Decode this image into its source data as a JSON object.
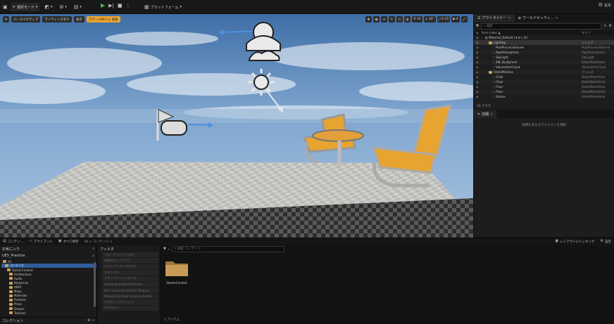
{
  "toolbar": {
    "mode": "選択モード",
    "platforms": "プラットフォーム"
  },
  "viewport": {
    "left_chips": [
      "パースペクティブ",
      "ライティングあり",
      "表示",
      "ステージIRシュ 再生"
    ],
    "numbers": [
      "10",
      "10°",
      "0.25",
      "4"
    ]
  },
  "outliner": {
    "tabs": [
      "アウトライナー",
      "ワールドセッティ..."
    ],
    "search_placeholder": "検索",
    "col_label": "Item Label ▲",
    "col_type": "タイプ",
    "rows": [
      {
        "label": "Material_Default (エディタ)",
        "type": "",
        "indent": 1,
        "kind": "world"
      },
      {
        "label": "Lighting",
        "type": "フォルダ",
        "indent": 2,
        "kind": "folder"
      },
      {
        "label": "PostProcessVolume",
        "type": "PostProcessVolume",
        "indent": 3,
        "kind": "actor"
      },
      {
        "label": "SkyAtmosphere",
        "type": "SkyAtmosphere",
        "indent": 3,
        "kind": "actor"
      },
      {
        "label": "SkyLight",
        "type": "SkyLight",
        "indent": 3,
        "kind": "actor"
      },
      {
        "label": "SM_SkySphere",
        "type": "StaticMeshActor",
        "indent": 3,
        "kind": "actor"
      },
      {
        "label": "VolumetricCloud",
        "type": "VolumetricCloud",
        "indent": 3,
        "kind": "actor"
      },
      {
        "label": "StaticMeshes",
        "type": "フォルダ",
        "indent": 2,
        "kind": "folder"
      },
      {
        "label": "Chair",
        "type": "StaticMeshActor",
        "indent": 3,
        "kind": "actor"
      },
      {
        "label": "Chair",
        "type": "StaticMeshActor",
        "indent": 3,
        "kind": "actor"
      },
      {
        "label": "Floor",
        "type": "StaticMeshActor",
        "indent": 3,
        "kind": "actor"
      },
      {
        "label": "Floor",
        "type": "StaticMeshActor",
        "indent": 3,
        "kind": "actor"
      },
      {
        "label": "Statue",
        "type": "StaticMeshActor",
        "indent": 3,
        "kind": "actor"
      }
    ],
    "footer": "16 アクタ"
  },
  "details": {
    "tab": "詳細",
    "empty_text": "詳細を見るオブジェクトを選択"
  },
  "bottombar": {
    "left_items": [
      "コンテン...",
      "アウトプット",
      "すべて保存"
    ],
    "breadcrumb": "All > コンテンツ >",
    "right_items": [
      "レイアウトにドッキング",
      "設定"
    ]
  },
  "sources": {
    "favorites": "お気に入り",
    "project": "UE5_Practice",
    "tree": [
      {
        "label": "All",
        "indent": 0,
        "selected": false
      },
      {
        "label": "コンテンツ",
        "indent": 1,
        "selected": true
      },
      {
        "label": "StarterContent",
        "indent": 2,
        "selected": false
      },
      {
        "label": "Architecture",
        "indent": 3,
        "selected": false
      },
      {
        "label": "Audio",
        "indent": 3,
        "selected": false
      },
      {
        "label": "Blueprints",
        "indent": 3,
        "selected": false
      },
      {
        "label": "HDRI",
        "indent": 3,
        "selected": false
      },
      {
        "label": "Maps",
        "indent": 3,
        "selected": false
      },
      {
        "label": "Materials",
        "indent": 3,
        "selected": false
      },
      {
        "label": "Particles",
        "indent": 3,
        "selected": false
      },
      {
        "label": "Props",
        "indent": 3,
        "selected": false
      },
      {
        "label": "Shapes",
        "indent": 3,
        "selected": false
      },
      {
        "label": "Textures",
        "indent": 3,
        "selected": false
      }
    ],
    "collections": "コレクション"
  },
  "filters": {
    "title": "フィルタ",
    "items": [
      "ブループリントクラス",
      "名前付きバリアント",
      "チェンジリストカテゴリ",
      "マテリアル",
      "マテリアルインスタンス",
      "Sound Speedline Sections",
      "Rich Surround Volume Texture",
      "Material Surface Instance Scene",
      "スタティックメッシュ",
      "テクスチャ"
    ]
  },
  "assets": {
    "search_placeholder": "検索 コンテンツ",
    "folder_name": "StarterContent",
    "count": "1 アイテム"
  }
}
